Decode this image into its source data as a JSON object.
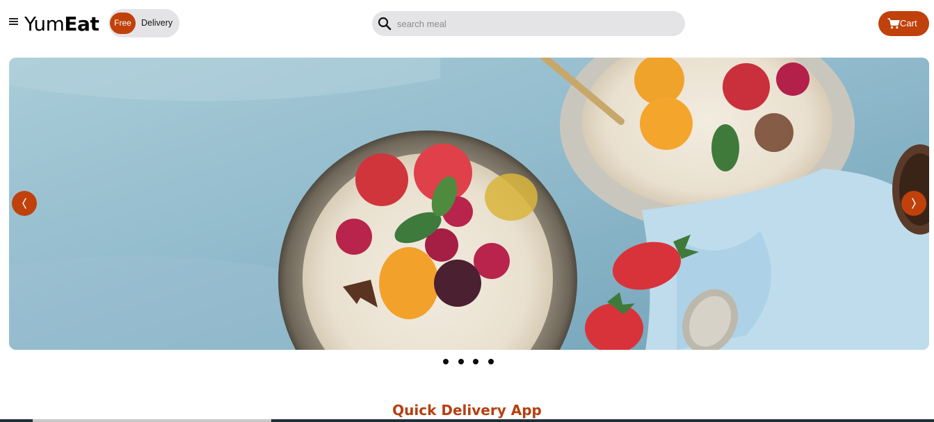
{
  "header": {
    "logo_regular": "Yum",
    "logo_bold": "Eat",
    "badge": "Free",
    "badge_text": "Delivery",
    "search_placeholder": "search meal",
    "cart_label": "Cart"
  },
  "carousel": {
    "prev_icon": "chevron-left-icon",
    "next_icon": "chevron-right-icon",
    "slide_count": 4
  },
  "section": {
    "title": "Quick Delivery App"
  },
  "colors": {
    "accent": "#c0410c",
    "title": "#b5400f",
    "pill_bg": "#e4e4e7"
  }
}
